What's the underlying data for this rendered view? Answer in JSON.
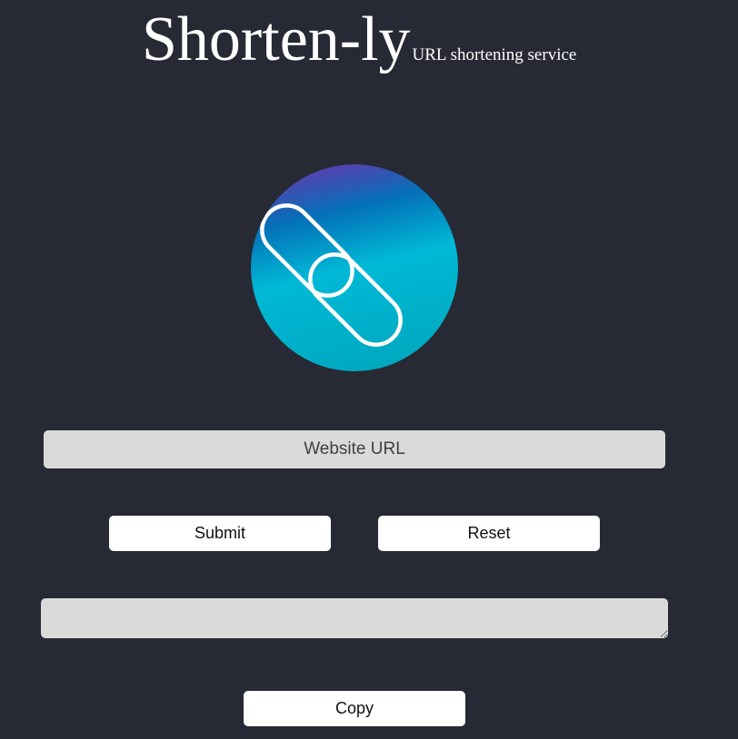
{
  "header": {
    "title": "Shorten-ly",
    "tagline": "URL shortening service"
  },
  "logo": {
    "icon": "link-chain-icon",
    "gradient_colors": [
      "#5a3fb0",
      "#0470b8",
      "#00b9d6",
      "#00a8bf"
    ]
  },
  "form": {
    "url_placeholder": "Website URL",
    "url_value": "",
    "submit_label": "Submit",
    "reset_label": "Reset",
    "output_value": "",
    "copy_label": "Copy"
  },
  "colors": {
    "background": "#272a34",
    "field_background": "#dadada",
    "button_background": "#ffffff"
  }
}
